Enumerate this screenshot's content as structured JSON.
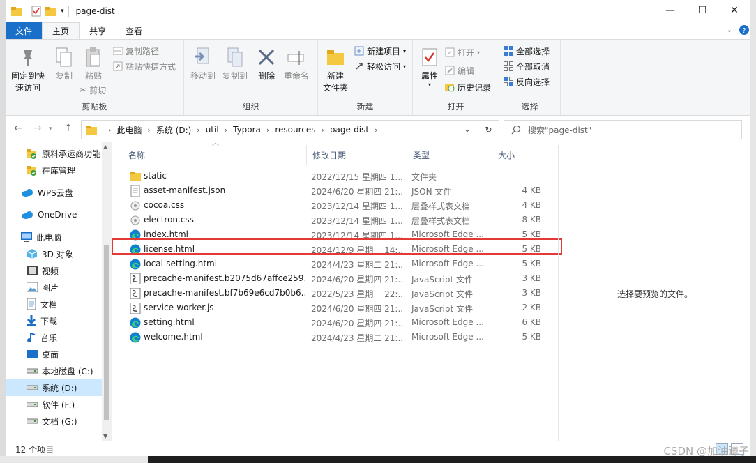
{
  "window": {
    "title": "page-dist",
    "controls": {
      "minimize": "—",
      "maximize": "☐",
      "close": "✕"
    }
  },
  "tabs": [
    "文件",
    "主页",
    "共享",
    "查看"
  ],
  "ribbon": {
    "clipboard": {
      "label": "剪贴板",
      "pin": "固定到快\n速访问",
      "copy": "复制",
      "paste": "粘贴",
      "copy_path": "复制路径",
      "paste_shortcut": "粘贴快捷方式",
      "cut": "剪切"
    },
    "organize": {
      "label": "组织",
      "move_to": "移动到",
      "copy_to": "复制到",
      "delete": "删除",
      "rename": "重命名"
    },
    "new": {
      "label": "新建",
      "new_folder": "新建\n文件夹",
      "new_item": "新建项目",
      "easy_access": "轻松访问"
    },
    "open": {
      "label": "打开",
      "properties": "属性",
      "open": "打开",
      "edit": "编辑",
      "history": "历史记录"
    },
    "select": {
      "label": "选择",
      "select_all": "全部选择",
      "select_none": "全部取消",
      "invert": "反向选择"
    }
  },
  "breadcrumb": [
    "此电脑",
    "系统 (D:)",
    "util",
    "Typora",
    "resources",
    "page-dist"
  ],
  "search": {
    "placeholder": "搜索\"page-dist\""
  },
  "nav": [
    {
      "label": "原料承运商功能",
      "icon": "folder-check-icon"
    },
    {
      "label": "在库管理",
      "icon": "folder-check-icon"
    },
    {
      "label": "WPS云盘",
      "icon": "cloud-icon"
    },
    {
      "label": "OneDrive",
      "icon": "cloud-icon"
    },
    {
      "label": "此电脑",
      "icon": "computer-icon"
    },
    {
      "label": "3D 对象",
      "icon": "cube-icon"
    },
    {
      "label": "视频",
      "icon": "video-icon"
    },
    {
      "label": "图片",
      "icon": "picture-icon"
    },
    {
      "label": "文档",
      "icon": "document-icon"
    },
    {
      "label": "下载",
      "icon": "download-icon"
    },
    {
      "label": "音乐",
      "icon": "music-icon"
    },
    {
      "label": "桌面",
      "icon": "desktop-icon"
    },
    {
      "label": "本地磁盘 (C:)",
      "icon": "drive-icon"
    },
    {
      "label": "系统 (D:)",
      "icon": "drive-icon"
    },
    {
      "label": "软件 (F:)",
      "icon": "drive-icon"
    },
    {
      "label": "文档 (G:)",
      "icon": "drive-icon"
    }
  ],
  "columns": [
    "名称",
    "修改日期",
    "类型",
    "大小"
  ],
  "files": [
    {
      "name": "static",
      "date": "2022/12/15 星期四 1...",
      "type": "文件夹",
      "size": "",
      "icon": "folder"
    },
    {
      "name": "asset-manifest.json",
      "date": "2024/6/20 星期四 21:...",
      "type": "JSON 文件",
      "size": "4 KB",
      "icon": "json"
    },
    {
      "name": "cocoa.css",
      "date": "2023/12/14 星期四 1...",
      "type": "层叠样式表文档",
      "size": "4 KB",
      "icon": "css"
    },
    {
      "name": "electron.css",
      "date": "2023/12/14 星期四 1...",
      "type": "层叠样式表文档",
      "size": "8 KB",
      "icon": "css"
    },
    {
      "name": "index.html",
      "date": "2023/12/14 星期四 1...",
      "type": "Microsoft Edge ...",
      "size": "5 KB",
      "icon": "edge"
    },
    {
      "name": "license.html",
      "date": "2024/12/9 星期一 14:...",
      "type": "Microsoft Edge ...",
      "size": "5 KB",
      "icon": "edge"
    },
    {
      "name": "local-setting.html",
      "date": "2024/4/23 星期二 21:...",
      "type": "Microsoft Edge ...",
      "size": "5 KB",
      "icon": "edge"
    },
    {
      "name": "precache-manifest.b2075d67affce259...",
      "date": "2024/6/20 星期四 21:...",
      "type": "JavaScript 文件",
      "size": "3 KB",
      "icon": "js"
    },
    {
      "name": "precache-manifest.bf7b69e6cd7b0b6...",
      "date": "2022/5/23 星期一 22:...",
      "type": "JavaScript 文件",
      "size": "3 KB",
      "icon": "js"
    },
    {
      "name": "service-worker.js",
      "date": "2024/6/20 星期四 21:...",
      "type": "JavaScript 文件",
      "size": "2 KB",
      "icon": "js"
    },
    {
      "name": "setting.html",
      "date": "2024/6/20 星期四 21:...",
      "type": "Microsoft Edge ...",
      "size": "6 KB",
      "icon": "edge"
    },
    {
      "name": "welcome.html",
      "date": "2024/4/23 星期二 21:...",
      "type": "Microsoft Edge ...",
      "size": "5 KB",
      "icon": "edge"
    }
  ],
  "preview_text": "选择要预览的文件。",
  "status": {
    "count": "12 个项目"
  },
  "watermark": "CSDN @加油蹲子"
}
